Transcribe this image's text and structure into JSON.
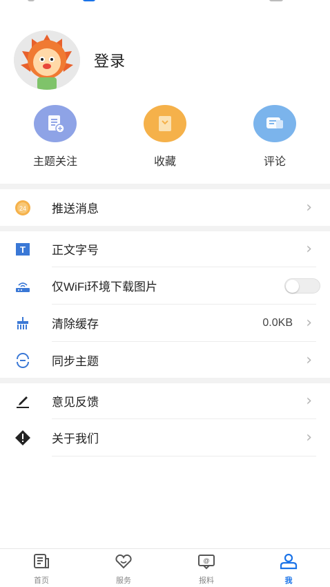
{
  "profile": {
    "login_label": "登录"
  },
  "quick_actions": [
    {
      "label": "主题关注",
      "icon": "topic-follow-icon",
      "color": "#8ea3e6"
    },
    {
      "label": "收藏",
      "icon": "favorites-icon",
      "color": "#f5b14a"
    },
    {
      "label": "评论",
      "icon": "comment-icon",
      "color": "#7bb4ec"
    }
  ],
  "settings": [
    {
      "label": "推送消息",
      "icon": "push-24-icon"
    },
    {
      "label": "正文字号",
      "icon": "font-size-icon"
    },
    {
      "label": "仅WiFi环境下载图片",
      "icon": "wifi-router-icon",
      "toggle_on": false
    },
    {
      "label": "清除缓存",
      "icon": "broom-icon",
      "value": "0.0KB"
    },
    {
      "label": "同步主题",
      "icon": "sync-theme-icon"
    },
    {
      "label": "意见反馈",
      "icon": "pen-feedback-icon"
    },
    {
      "label": "关于我们",
      "icon": "info-diamond-icon"
    }
  ],
  "tabbar": [
    {
      "label": "首页",
      "icon": "home-news-icon"
    },
    {
      "label": "服务",
      "icon": "heart-service-icon"
    },
    {
      "label": "报料",
      "icon": "report-icon"
    },
    {
      "label": "我",
      "icon": "user-icon",
      "active": true
    }
  ],
  "colors": {
    "accent": "#1a73e8",
    "chevron": "#b5b5b5"
  }
}
